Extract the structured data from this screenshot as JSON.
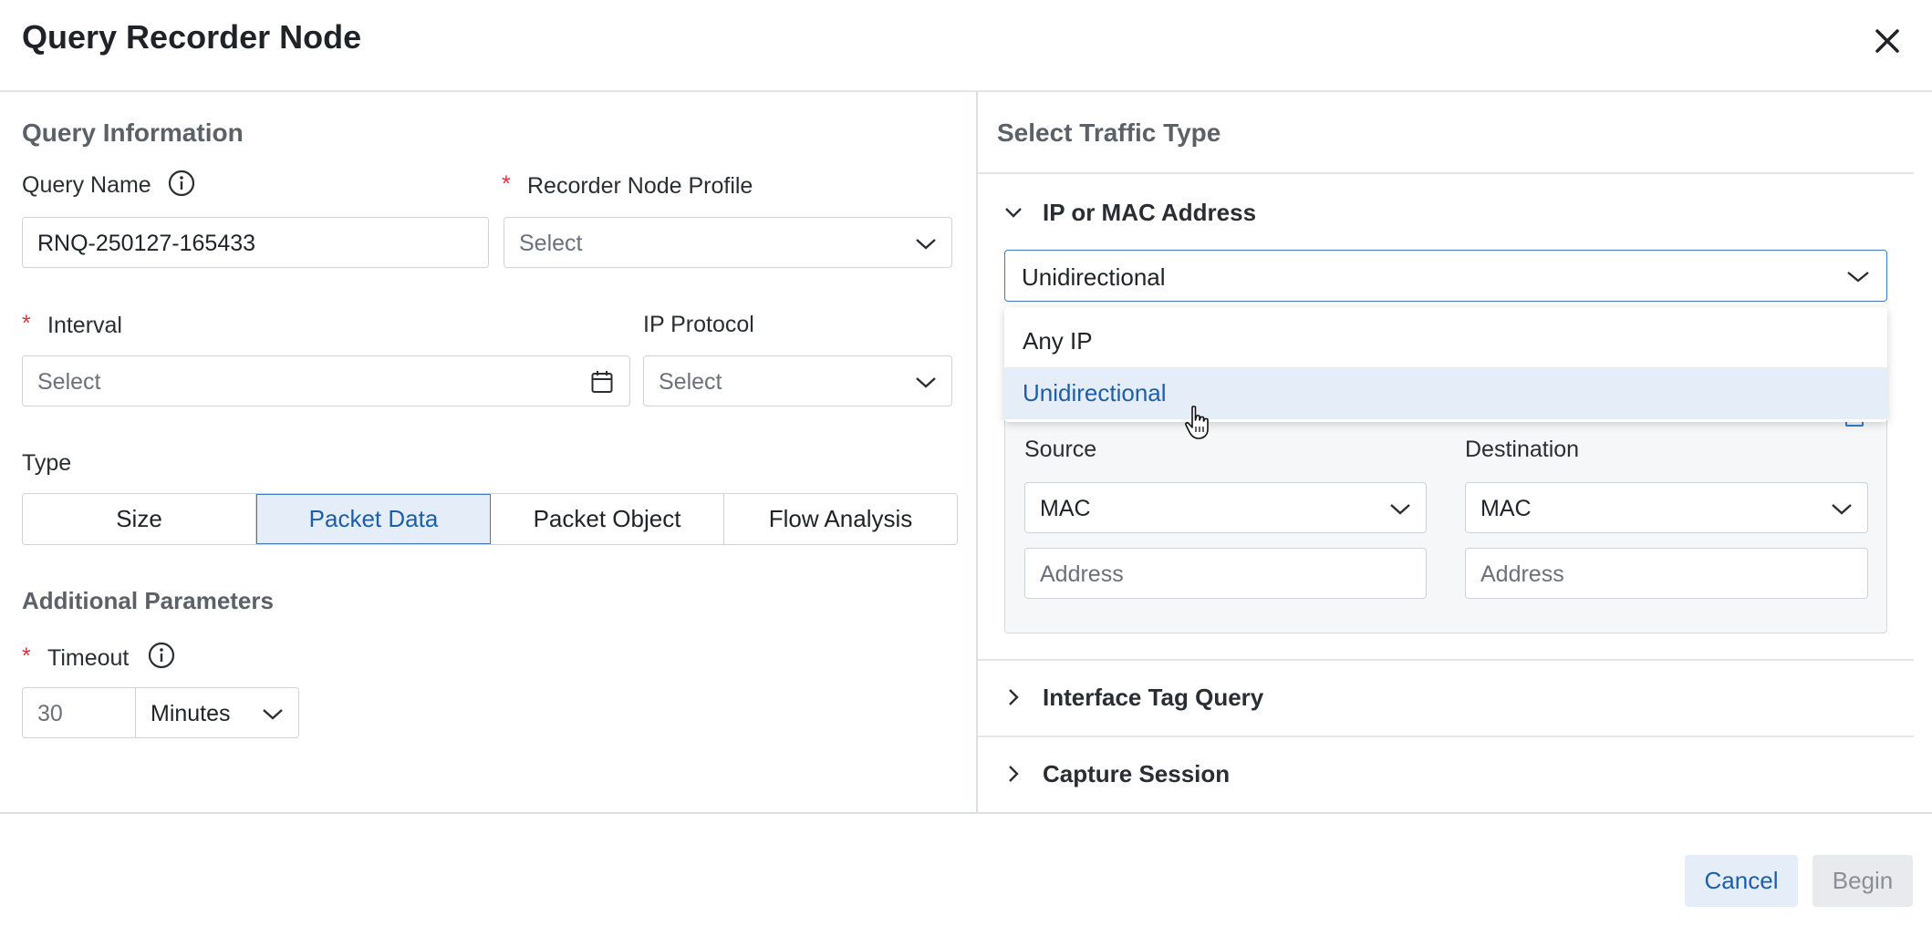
{
  "dialog": {
    "title": "Query Recorder Node",
    "close_icon": "close-icon"
  },
  "query_info": {
    "section_title": "Query Information",
    "query_name_label": "Query Name",
    "query_name_value": "RNQ-250127-165433",
    "profile_label": "Recorder Node Profile",
    "profile_placeholder": "Select",
    "interval_label": "Interval",
    "interval_placeholder": "Select",
    "protocol_label": "IP Protocol",
    "protocol_placeholder": "Select",
    "required_mark": "*"
  },
  "type": {
    "label": "Type",
    "options": [
      "Size",
      "Packet Data",
      "Packet Object",
      "Flow Analysis"
    ],
    "selected": "Packet Data"
  },
  "additional": {
    "section_title": "Additional Parameters",
    "timeout_label": "Timeout",
    "timeout_value": "30",
    "timeout_unit": "Minutes"
  },
  "traffic": {
    "section_title": "Select Traffic Type",
    "ip_mac": {
      "title": "IP or MAC Address",
      "mode_value": "Unidirectional",
      "dropdown_options": [
        "Any IP",
        "Unidirectional"
      ],
      "highlighted_option": "Unidirectional",
      "source_label": "Source",
      "source_type": "MAC",
      "source_placeholder": "Address",
      "destination_label": "Destination",
      "destination_type": "MAC",
      "destination_placeholder": "Address"
    },
    "interface_tag": {
      "title": "Interface Tag Query"
    },
    "capture_session": {
      "title": "Capture Session"
    }
  },
  "footer": {
    "cancel_label": "Cancel",
    "begin_label": "Begin"
  },
  "colors": {
    "accent": "#1c5fa8",
    "required": "#d9363e",
    "selected_bg": "#e5eef8"
  }
}
